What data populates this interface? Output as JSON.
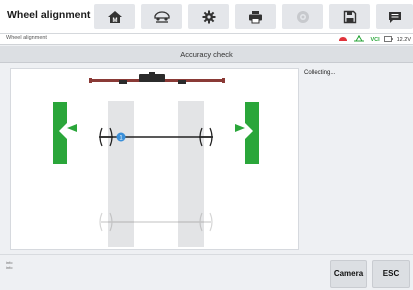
{
  "app": {
    "title": "Wheel alignment"
  },
  "toolbar": {
    "buttons": [
      {
        "icon": "home-icon"
      },
      {
        "icon": "vehicle-lift-icon"
      },
      {
        "icon": "settings-gear-icon"
      },
      {
        "icon": "printer-icon"
      },
      {
        "icon": "camera-lens-icon"
      },
      {
        "icon": "save-icon"
      },
      {
        "icon": "message-icon"
      }
    ]
  },
  "statusbar": {
    "breadcrumb": "Wheel alignment",
    "vci_label": "VCI",
    "battery_text": "12.2V",
    "colors": {
      "car": "#e0323a",
      "vci": "#2aa63a"
    }
  },
  "section": {
    "title": "Accuracy check"
  },
  "info": {
    "status_text": "Collecting..."
  },
  "bottom": {
    "info_line1": "info",
    "info_line2": "info",
    "camera_label": "Camera",
    "esc_label": "ESC"
  },
  "diagram": {
    "colors": {
      "target": "#2aa63a",
      "axle": "#222222",
      "marker": "#3a8fd9",
      "lift": "#8a3a36"
    }
  }
}
